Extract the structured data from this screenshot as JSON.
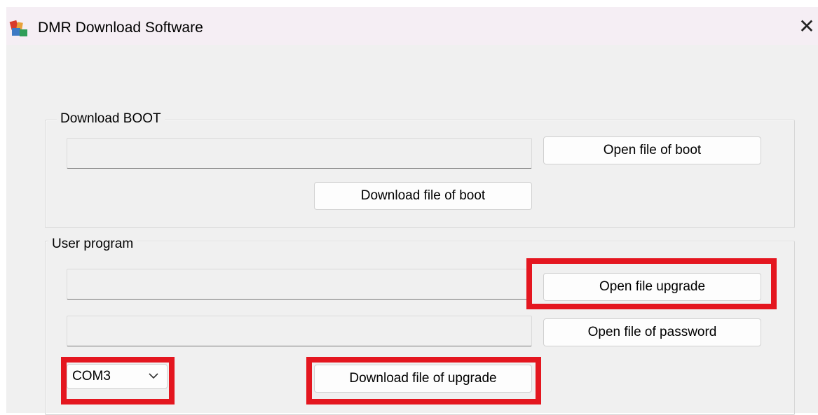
{
  "window": {
    "title": "DMR Download Software",
    "close_label": "✕"
  },
  "boot_group": {
    "label": "Download BOOT",
    "boot_file_path": "",
    "open_boot_label": "Open file of boot",
    "download_boot_label": "Download file of boot"
  },
  "user_group": {
    "label": "User program",
    "upgrade_file_path": "",
    "password_file_path": "",
    "open_upgrade_label": "Open file upgrade",
    "open_password_label": "Open file of password",
    "port_value": "COM3",
    "download_upgrade_label": "Download file of upgrade"
  },
  "annotation_color": "#e4161f"
}
